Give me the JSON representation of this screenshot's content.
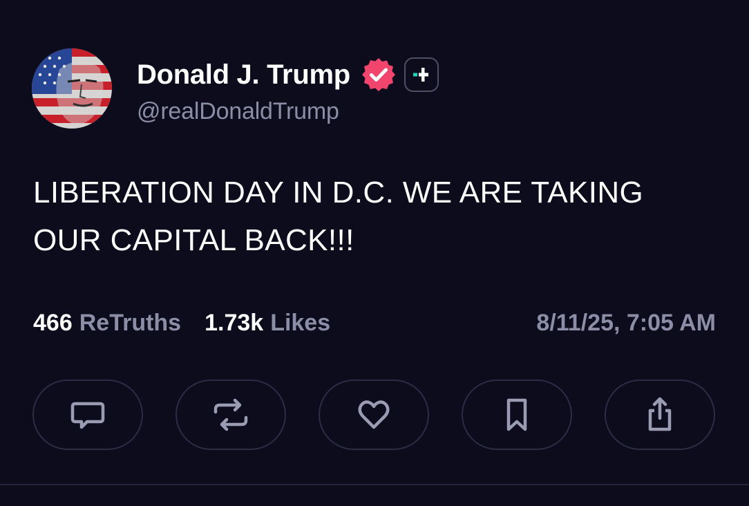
{
  "author": {
    "display_name": "Donald J. Trump",
    "handle": "@realDonaldTrump",
    "verified_icon": "verified-badge-icon",
    "verified_color": "#f2456e",
    "plus_icon": "plus-icon",
    "plus_accent": "#23d3b5"
  },
  "post": {
    "text": "LIBERATION DAY IN D.C. WE ARE TAKING OUR CAPITAL BACK!!!"
  },
  "stats": {
    "retruths_count": "466",
    "retruths_label": "ReTruths",
    "likes_count": "1.73k",
    "likes_label": "Likes",
    "timestamp": "8/11/25, 7:05 AM"
  },
  "actions": [
    {
      "name": "reply",
      "icon": "reply-icon"
    },
    {
      "name": "retruth",
      "icon": "retruth-icon"
    },
    {
      "name": "like",
      "icon": "heart-icon"
    },
    {
      "name": "bookmark",
      "icon": "bookmark-icon"
    },
    {
      "name": "share",
      "icon": "share-icon"
    }
  ],
  "colors": {
    "background": "#0c0c1d",
    "text_primary": "#ffffff",
    "text_secondary": "#8b8ea6",
    "button_border": "#2c2d45",
    "icon_color": "#9a9cb3"
  }
}
